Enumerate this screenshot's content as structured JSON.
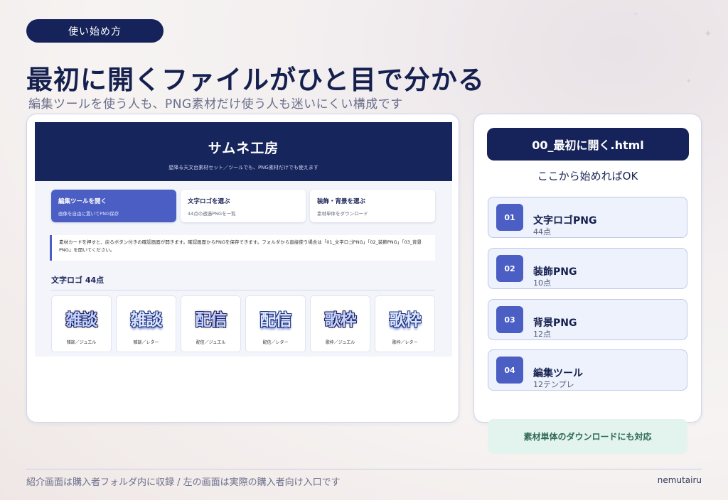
{
  "top_pill": "使い始め方",
  "headline": "最初に開くファイルがひと目で分かる",
  "subline": "編集ツールを使う人も、PNG素材だけ使う人も迷いにくい構成です",
  "preview": {
    "title": "サムネ工房",
    "subtitle": "星降る天文台素材セット／ツールでも、PNG素材だけでも使えます",
    "tabs": [
      {
        "title": "編集ツールを開く",
        "desc": "画像を自由に置いてPNG保存"
      },
      {
        "title": "文字ロゴを選ぶ",
        "desc": "44点の透過PNGを一覧"
      },
      {
        "title": "装飾・背景を選ぶ",
        "desc": "素材単体をダウンロード"
      }
    ],
    "note": "素材カードを押すと、戻るボタン付きの確認画面が開きます。確認画面からPNGを保存できます。フォルダから直接使う場合は「01_文字ロゴPNG」「02_装飾PNG」「03_背景PNG」を開いてください。",
    "section_title": "文字ロゴ 44点",
    "items": [
      {
        "art": "雑談",
        "label": "雑談／ジュエル",
        "style": "a"
      },
      {
        "art": "雑談",
        "label": "雑談／レター",
        "style": "b"
      },
      {
        "art": "配信",
        "label": "配信／ジュエル",
        "style": "a"
      },
      {
        "art": "配信",
        "label": "配信／レター",
        "style": "b"
      },
      {
        "art": "歌枠",
        "label": "歌枠／ジュエル",
        "style": "a"
      },
      {
        "art": "歌枠",
        "label": "歌枠／レター",
        "style": "b"
      }
    ]
  },
  "right": {
    "file_name": "00_最初に開く.html",
    "start_text": "ここから始めればOK",
    "steps": [
      {
        "num": "01",
        "title": "文字ロゴPNG",
        "sub": "44点"
      },
      {
        "num": "02",
        "title": "装飾PNG",
        "sub": "10点"
      },
      {
        "num": "03",
        "title": "背景PNG",
        "sub": "12点"
      },
      {
        "num": "04",
        "title": "編集ツール",
        "sub": "12テンプレ"
      }
    ]
  },
  "badge": "素材単体のダウンロードにも対応",
  "footer": {
    "left": "紹介画面は購入者フォルダ内に収録 / 左の画面は実際の購入者向け入口です",
    "right": "nemutairu"
  }
}
